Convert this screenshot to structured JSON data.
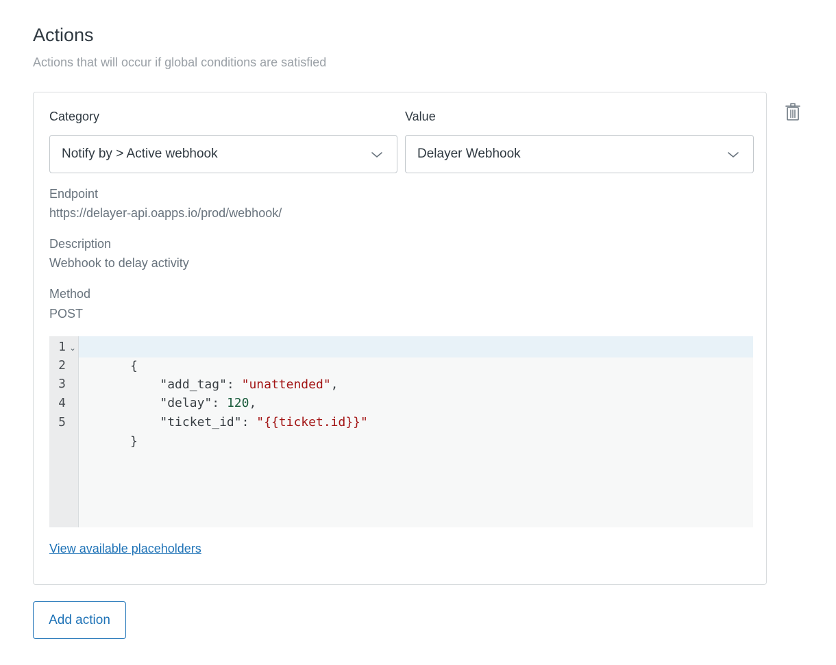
{
  "section": {
    "title": "Actions",
    "subtitle": "Actions that will occur if global conditions are satisfied"
  },
  "action": {
    "category": {
      "label": "Category",
      "selected": "Notify by > Active webhook"
    },
    "value": {
      "label": "Value",
      "selected": "Delayer Webhook"
    },
    "endpoint": {
      "label": "Endpoint",
      "value": "https://delayer-api.oapps.io/prod/webhook/"
    },
    "description": {
      "label": "Description",
      "value": "Webhook to delay activity"
    },
    "method": {
      "label": "Method",
      "value": "POST"
    },
    "code": {
      "line_numbers": [
        "1",
        "2",
        "3",
        "4",
        "5"
      ],
      "lines": [
        [
          {
            "t": "{",
            "k": "punc"
          }
        ],
        [
          {
            "t": "    \"add_tag\"",
            "k": "key"
          },
          {
            "t": ": ",
            "k": "punc"
          },
          {
            "t": "\"unattended\"",
            "k": "str"
          },
          {
            "t": ",",
            "k": "punc"
          }
        ],
        [
          {
            "t": "    \"delay\"",
            "k": "key"
          },
          {
            "t": ": ",
            "k": "punc"
          },
          {
            "t": "120",
            "k": "num"
          },
          {
            "t": ",",
            "k": "punc"
          }
        ],
        [
          {
            "t": "    \"ticket_id\"",
            "k": "key"
          },
          {
            "t": ": ",
            "k": "punc"
          },
          {
            "t": "\"{{ticket.id}}\"",
            "k": "str"
          }
        ],
        [
          {
            "t": "}",
            "k": "punc"
          }
        ]
      ]
    },
    "placeholders_link": "View available placeholders",
    "delete_icon": "trash-icon"
  },
  "add_action_label": "Add action",
  "colors": {
    "accent": "#1f73b7",
    "string": "#a31515",
    "number": "#1a5c3c",
    "active_line": "#e8f2f8"
  }
}
